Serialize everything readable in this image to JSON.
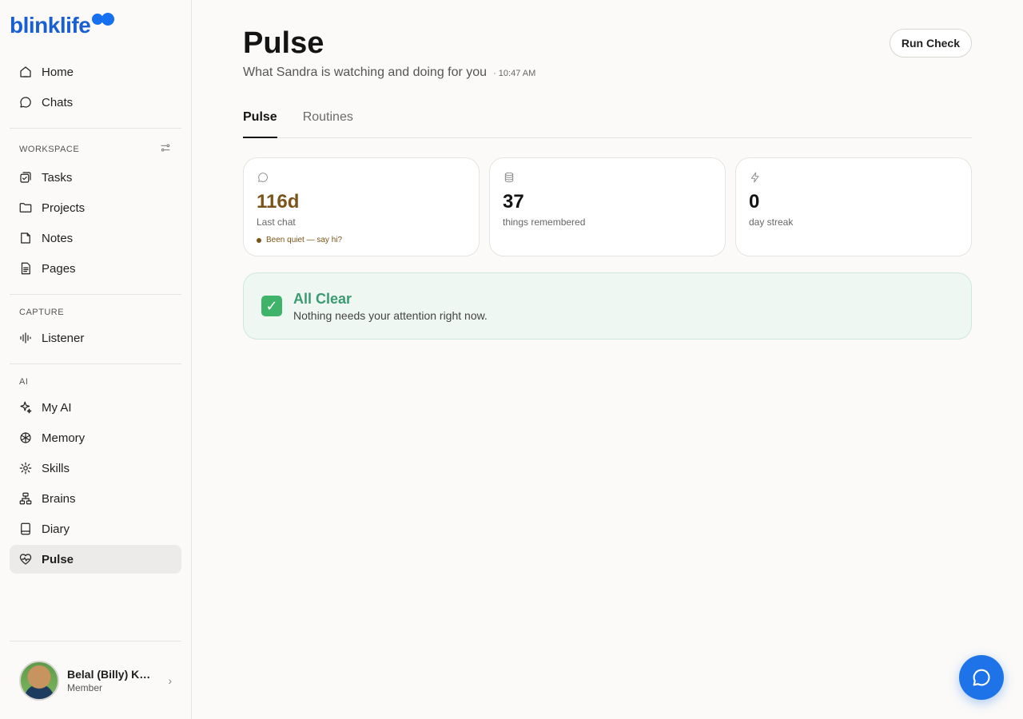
{
  "brand": {
    "logo_text": "blinklife",
    "accent": "#1e73e8"
  },
  "sidebar": {
    "top_items": [
      {
        "label": "Home",
        "icon": "home-icon"
      },
      {
        "label": "Chats",
        "icon": "chat-icon"
      }
    ],
    "sections": [
      {
        "label": "WORKSPACE",
        "items": [
          {
            "label": "Tasks",
            "icon": "tasks-icon"
          },
          {
            "label": "Projects",
            "icon": "folder-icon"
          },
          {
            "label": "Notes",
            "icon": "note-icon"
          },
          {
            "label": "Pages",
            "icon": "page-icon"
          }
        ]
      },
      {
        "label": "CAPTURE",
        "items": [
          {
            "label": "Listener",
            "icon": "waveform-icon"
          }
        ]
      },
      {
        "label": "AI",
        "items": [
          {
            "label": "My AI",
            "icon": "sparkle-icon"
          },
          {
            "label": "Memory",
            "icon": "memory-icon"
          },
          {
            "label": "Skills",
            "icon": "skills-icon"
          },
          {
            "label": "Brains",
            "icon": "brains-icon"
          },
          {
            "label": "Diary",
            "icon": "diary-icon"
          },
          {
            "label": "Pulse",
            "icon": "heart-pulse-icon",
            "active": true
          }
        ]
      }
    ],
    "profile": {
      "name": "Belal (Billy) Kh...",
      "role": "Member"
    }
  },
  "main": {
    "title": "Pulse",
    "subtitle": "What Sandra is watching and doing for you",
    "time": "· 10:47 AM",
    "run_check_label": "Run Check",
    "tabs": [
      {
        "label": "Pulse",
        "active": true
      },
      {
        "label": "Routines",
        "active": false
      }
    ],
    "cards": [
      {
        "icon": "chat-bubble-icon",
        "value": "116d",
        "label": "Last chat",
        "note": "Been quiet — say hi?"
      },
      {
        "icon": "database-icon",
        "value": "37",
        "label": "things remembered"
      },
      {
        "icon": "lightning-icon",
        "value": "0",
        "label": "day streak"
      }
    ],
    "status": {
      "title": "All Clear",
      "message": "Nothing needs your attention right now.",
      "color": "#3a9a72"
    }
  }
}
